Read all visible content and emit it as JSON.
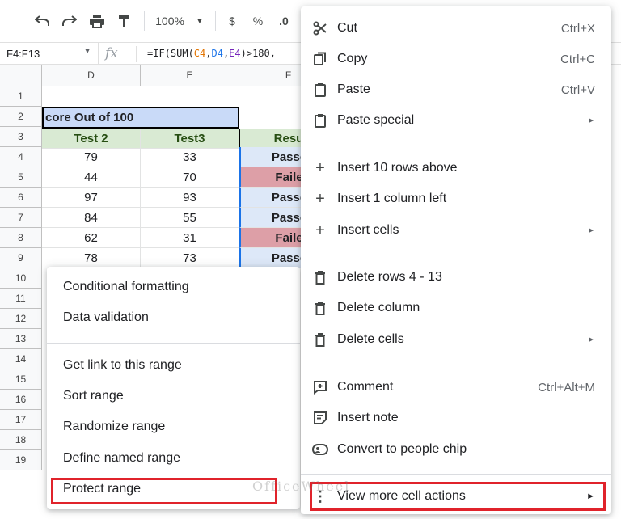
{
  "toolbar": {
    "undo_icon": "undo-icon",
    "redo_icon": "redo-icon",
    "print_icon": "print-icon",
    "paint_icon": "paint-format-icon",
    "zoom": "100%",
    "currency": "$",
    "percent": "%",
    "decimal": ".0"
  },
  "formula_bar": {
    "name_box": "F4:F13",
    "fx": "fx",
    "formula_prefix": "=IF(SUM(",
    "ref_c": "C4",
    "ref_d": "D4",
    "ref_e": "E4",
    "formula_suffix": ")>180,"
  },
  "grid": {
    "columns": [
      "D",
      "E",
      "F"
    ],
    "rows": [
      "1",
      "2",
      "3",
      "4",
      "5",
      "6",
      "7",
      "8",
      "9",
      "10",
      "11",
      "12",
      "13",
      "14",
      "15",
      "16",
      "17",
      "18",
      "19"
    ],
    "title": "core Out of 100",
    "headers": {
      "d": "Test 2",
      "e": "Test3",
      "f": "Resu"
    },
    "data": [
      {
        "d": "79",
        "e": "33",
        "f": "Passe",
        "status": "pass"
      },
      {
        "d": "44",
        "e": "70",
        "f": "Faile",
        "status": "fail"
      },
      {
        "d": "97",
        "e": "93",
        "f": "Passe",
        "status": "pass"
      },
      {
        "d": "84",
        "e": "55",
        "f": "Passe",
        "status": "pass"
      },
      {
        "d": "62",
        "e": "31",
        "f": "Faile",
        "status": "fail"
      },
      {
        "d": "78",
        "e": "73",
        "f": "Passe",
        "status": "pass"
      }
    ]
  },
  "left_menu": {
    "items": [
      "Conditional formatting",
      "Data validation",
      "Get link to this range",
      "Sort range",
      "Randomize range",
      "Define named range",
      "Protect range"
    ]
  },
  "right_menu": {
    "items": [
      {
        "label": "Cut",
        "shortcut": "Ctrl+X",
        "icon": "scissors-icon"
      },
      {
        "label": "Copy",
        "shortcut": "Ctrl+C",
        "icon": "copy-icon"
      },
      {
        "label": "Paste",
        "shortcut": "Ctrl+V",
        "icon": "clipboard-icon"
      },
      {
        "label": "Paste special",
        "icon": "clipboard-icon"
      },
      {
        "label": "Insert 10 rows above",
        "icon": "plus-icon"
      },
      {
        "label": "Insert 1 column left",
        "icon": "plus-icon"
      },
      {
        "label": "Insert cells",
        "icon": "plus-icon"
      },
      {
        "label": "Delete rows 4 - 13",
        "icon": "trash-icon"
      },
      {
        "label": "Delete column",
        "icon": "trash-icon"
      },
      {
        "label": "Delete cells",
        "icon": "trash-icon"
      },
      {
        "label": "Comment",
        "shortcut": "Ctrl+Alt+M",
        "icon": "comment-add-icon"
      },
      {
        "label": "Insert note",
        "icon": "note-icon"
      },
      {
        "label": "Convert to people chip",
        "icon": "people-chip-icon"
      },
      {
        "label": "View more cell actions",
        "icon": "more-vert-icon"
      }
    ]
  },
  "watermark": "OfficeWheel",
  "colors": {
    "highlight": "#e0232b",
    "title_bg": "#c9daf8",
    "header_bg": "#d9ead3",
    "pass_bg": "#dde8f8",
    "fail_bg": "#dd9fa7"
  }
}
